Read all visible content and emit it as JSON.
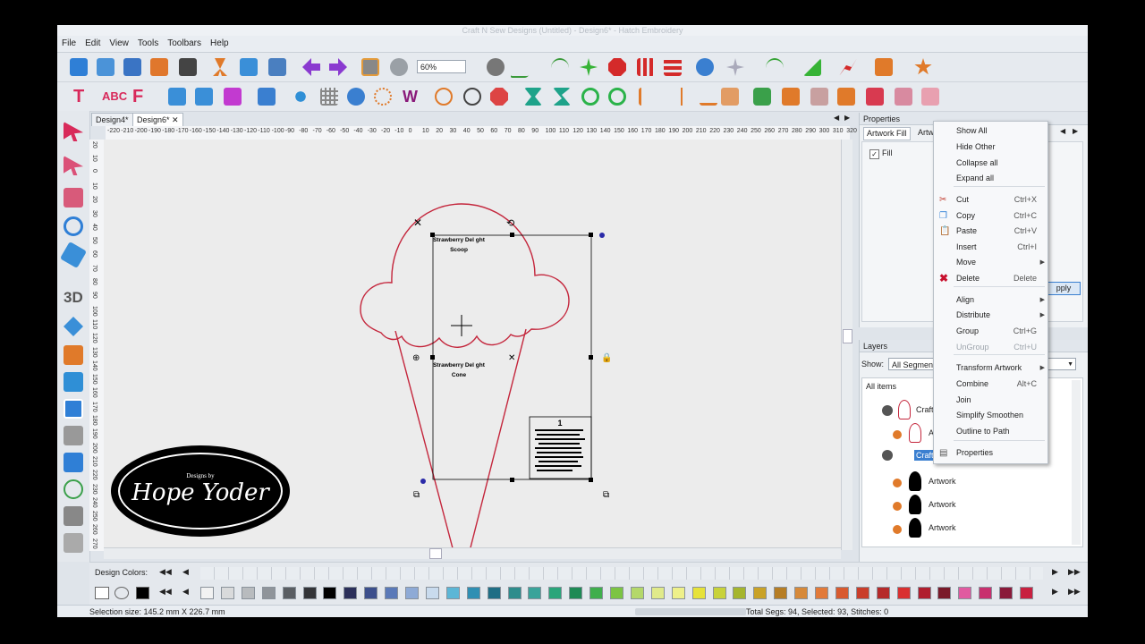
{
  "window": {
    "title": "Craft N Sew Designs (Untitled) - Design6* - Hatch Embroidery"
  },
  "menu": [
    "File",
    "Edit",
    "View",
    "Tools",
    "Toolbars",
    "Help"
  ],
  "toolbar": {
    "zoom": "60%"
  },
  "doc_tabs": [
    "Design4*",
    "Design6*"
  ],
  "ruler": {
    "h": [
      "-220",
      "-210",
      "-200",
      "-190",
      "-180",
      "-170",
      "-160",
      "-150",
      "-140",
      "-130",
      "-120",
      "-110",
      "-100",
      "-90",
      "-80",
      "-70",
      "-60",
      "-50",
      "-40",
      "-30",
      "-20",
      "-10",
      "0",
      "10",
      "20",
      "30",
      "40",
      "50",
      "60",
      "70",
      "80",
      "90",
      "100",
      "110",
      "120",
      "130",
      "140",
      "150",
      "160",
      "170",
      "180",
      "190",
      "200",
      "210",
      "220",
      "230",
      "240",
      "250",
      "260",
      "270",
      "280",
      "290",
      "300",
      "310",
      "320"
    ],
    "v": [
      "20",
      "10",
      "0",
      "10",
      "20",
      "30",
      "40",
      "50",
      "60",
      "70",
      "80",
      "90",
      "100",
      "110",
      "120",
      "130",
      "140",
      "150",
      "160",
      "170",
      "180",
      "190",
      "200",
      "210",
      "220",
      "230",
      "240",
      "250",
      "260",
      "270"
    ]
  },
  "canvas": {
    "text1a": "Strawberry Del ght",
    "text1b": "Scoop",
    "text2a": "Strawberry Del ght",
    "text2b": "Cone",
    "note_num": "1"
  },
  "logo": {
    "small": "Designs by",
    "name": "Hope Yoder"
  },
  "properties": {
    "title": "Properties",
    "tab1": "Artwork Fill",
    "tab2": "Artw",
    "fill_label": "Fill",
    "apply": "pply"
  },
  "layers": {
    "title": "Layers",
    "show_label": "Show:",
    "show_value": "All Segments",
    "all_items": "All items",
    "rows": [
      {
        "label": "Craft"
      },
      {
        "label": "A"
      },
      {
        "label": "Craft"
      },
      {
        "label": "Artwork"
      },
      {
        "label": "Artwork"
      },
      {
        "label": "Artwork"
      }
    ]
  },
  "context_menu": [
    {
      "label": "Show All",
      "shortcut": "",
      "arrow": false,
      "icon": ""
    },
    {
      "label": "Hide Other",
      "shortcut": "",
      "arrow": false,
      "icon": ""
    },
    {
      "label": "Collapse all",
      "shortcut": "",
      "arrow": false,
      "icon": ""
    },
    {
      "label": "Expand all",
      "shortcut": "",
      "arrow": false,
      "icon": ""
    },
    {
      "label": "Cut",
      "shortcut": "Ctrl+X",
      "arrow": false,
      "icon": "cut"
    },
    {
      "label": "Copy",
      "shortcut": "Ctrl+C",
      "arrow": false,
      "icon": "copy"
    },
    {
      "label": "Paste",
      "shortcut": "Ctrl+V",
      "arrow": false,
      "icon": "paste"
    },
    {
      "label": "Insert",
      "shortcut": "Ctrl+I",
      "arrow": false,
      "icon": ""
    },
    {
      "label": "Move",
      "shortcut": "",
      "arrow": true,
      "icon": ""
    },
    {
      "label": "Delete",
      "shortcut": "Delete",
      "arrow": false,
      "icon": "delete"
    },
    {
      "label": "Align",
      "shortcut": "",
      "arrow": true,
      "icon": ""
    },
    {
      "label": "Distribute",
      "shortcut": "",
      "arrow": true,
      "icon": ""
    },
    {
      "label": "Group",
      "shortcut": "Ctrl+G",
      "arrow": false,
      "icon": ""
    },
    {
      "label": "UnGroup",
      "shortcut": "Ctrl+U",
      "arrow": false,
      "icon": "",
      "disabled": true
    },
    {
      "label": "Transform Artwork",
      "shortcut": "",
      "arrow": true,
      "icon": ""
    },
    {
      "label": "Combine",
      "shortcut": "Alt+C",
      "arrow": false,
      "icon": ""
    },
    {
      "label": "Join",
      "shortcut": "",
      "arrow": false,
      "icon": ""
    },
    {
      "label": "Simplify Smoothen",
      "shortcut": "",
      "arrow": false,
      "icon": ""
    },
    {
      "label": "Outline to Path",
      "shortcut": "",
      "arrow": false,
      "icon": ""
    },
    {
      "label": "Properties",
      "shortcut": "",
      "arrow": false,
      "icon": "properties"
    }
  ],
  "color_bar": {
    "label": "Design Colors:"
  },
  "palette": [
    "#f2f2f2",
    "#d9dadb",
    "#b8bbbe",
    "#8f949a",
    "#5a5e63",
    "#333438",
    "#000000",
    "#2b2f5a",
    "#3c4f8c",
    "#5a79b8",
    "#8eaad6",
    "#c9dbee",
    "#5cb6d6",
    "#2f8fb3",
    "#1f6e85",
    "#2e8c8c",
    "#3aa39a",
    "#2aa57a",
    "#1e8a55",
    "#3fae4c",
    "#7cc443",
    "#b4d86a",
    "#e0ea8a",
    "#eef08a",
    "#e6e23a",
    "#c8d23a",
    "#a5b52d",
    "#c9a227",
    "#b67d24",
    "#d6893a",
    "#e27a3a",
    "#d85a2f",
    "#c93d2a",
    "#b52a2a",
    "#d93030",
    "#b01e2e",
    "#7a1a2a",
    "#e05aa0",
    "#c8306e",
    "#8a1a3a",
    "#c82040"
  ],
  "status": {
    "selection": "Selection size: 145.2 mm X 226.7 mm",
    "totals": "Total Segs: 94, Selected: 93, Stitches: 0"
  }
}
